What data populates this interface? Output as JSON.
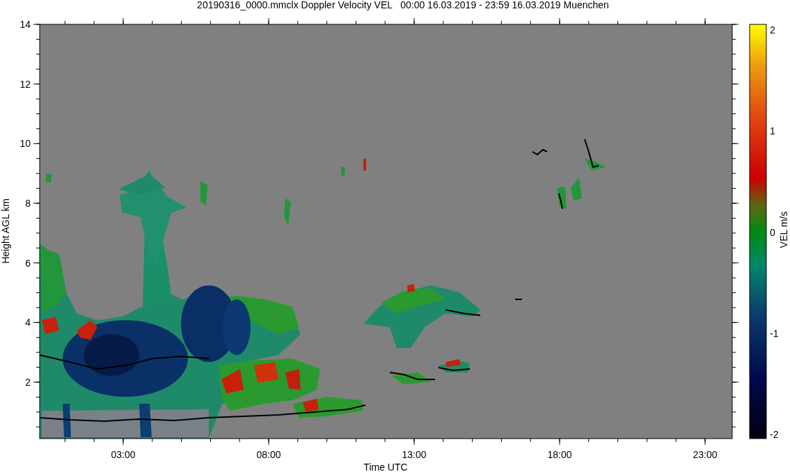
{
  "title": "20190316_0000.mmclx Doppler Velocity VEL   00:00 16.03.2019 - 23:59 16.03.2019 Muenchen",
  "y_axis": {
    "label": "Height AGL km",
    "ticks": [
      "14",
      "12",
      "10",
      "8",
      "6",
      "4",
      "2"
    ]
  },
  "x_axis": {
    "label": "Time UTC",
    "ticks": [
      "03:00",
      "08:00",
      "13:00",
      "18:00",
      "23:00"
    ]
  },
  "colorbar": {
    "label": "VEL m/s",
    "ticks": [
      "2",
      "1",
      "0",
      "-1",
      "-2"
    ]
  }
}
